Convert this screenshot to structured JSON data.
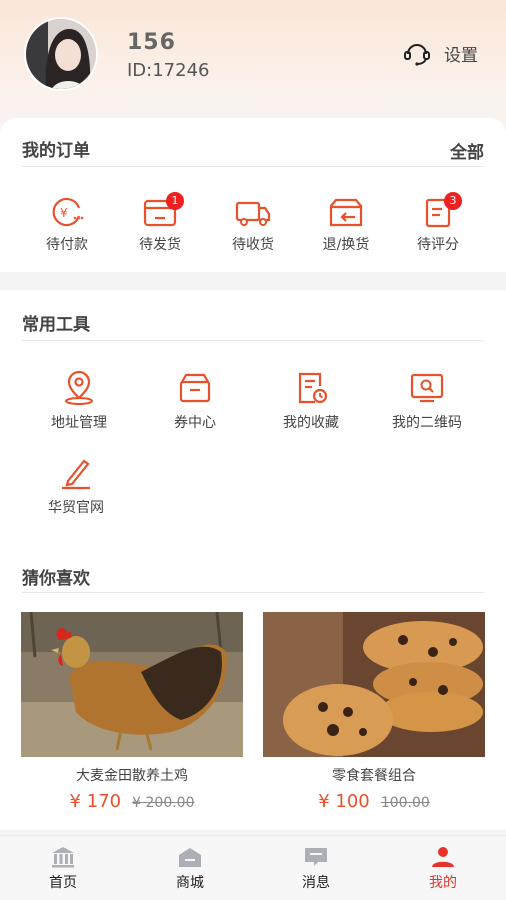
{
  "user": {
    "name": "156",
    "id_text": "ID:17246"
  },
  "header": {
    "settings_label": "设置"
  },
  "orders": {
    "title": "我的订单",
    "all_label": "全部",
    "items": [
      {
        "label": "待付款",
        "icon": "yen-coin-icon",
        "badge": ""
      },
      {
        "label": "待发货",
        "icon": "box-icon",
        "badge": "1"
      },
      {
        "label": "待收货",
        "icon": "truck-icon",
        "badge": ""
      },
      {
        "label": "退/换货",
        "icon": "return-box-icon",
        "badge": ""
      },
      {
        "label": "待评分",
        "icon": "clipboard-icon",
        "badge": "3"
      }
    ]
  },
  "tools": {
    "title": "常用工具",
    "items": [
      {
        "label": "地址管理",
        "icon": "location-pin-icon"
      },
      {
        "label": "券中心",
        "icon": "coupon-box-icon"
      },
      {
        "label": "我的收藏",
        "icon": "favorites-doc-icon"
      },
      {
        "label": "我的二维码",
        "icon": "qr-monitor-icon"
      },
      {
        "label": "华贸官网",
        "icon": "pen-icon"
      }
    ]
  },
  "recommend": {
    "title": "猜你喜欢",
    "products": [
      {
        "name": "大麦金田散养土鸡",
        "price": "¥ 170",
        "old_price": "¥ 200.00",
        "image": "hen-photo"
      },
      {
        "name": "零食套餐组合",
        "price": "¥ 100",
        "old_price": "100.00",
        "image": "cookies-photo"
      }
    ]
  },
  "tabbar": {
    "items": [
      {
        "label": "首页",
        "icon": "bank-icon",
        "active": false
      },
      {
        "label": "商城",
        "icon": "store-icon",
        "active": false
      },
      {
        "label": "消息",
        "icon": "message-icon",
        "active": false
      },
      {
        "label": "我的",
        "icon": "user-icon",
        "active": true
      }
    ]
  },
  "colors": {
    "accent": "#e8512b",
    "active_tab": "#e8332b",
    "badge": "#ee2020"
  }
}
